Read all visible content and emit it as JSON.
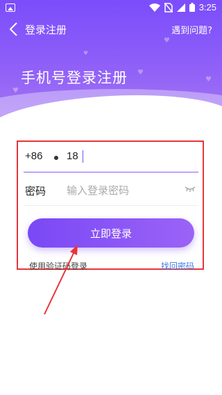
{
  "status_bar": {
    "time": "3:25",
    "icons": [
      "gallery-icon",
      "wifi-icon",
      "no-sim-icon",
      "signal-icon",
      "battery-icon"
    ]
  },
  "nav": {
    "back_icon": "chevron-left-icon",
    "title": "登录注册",
    "help_link": "遇到问题?"
  },
  "header": {
    "page_title": "手机号登录注册",
    "gradient_colors": [
      "#7b4dfb",
      "#a275f3"
    ]
  },
  "form": {
    "country_code": "+86",
    "phone_value": "18",
    "password_label": "密码",
    "password_placeholder": "输入登录密码",
    "eye_icon": "eye-closed-icon",
    "login_button": "立即登录",
    "sms_login": "使用验证码登录",
    "forgot_password": "找回密码"
  },
  "colors": {
    "accent": "#7b4dfb",
    "link": "#3f7de8",
    "annotation": "#e8343a"
  }
}
